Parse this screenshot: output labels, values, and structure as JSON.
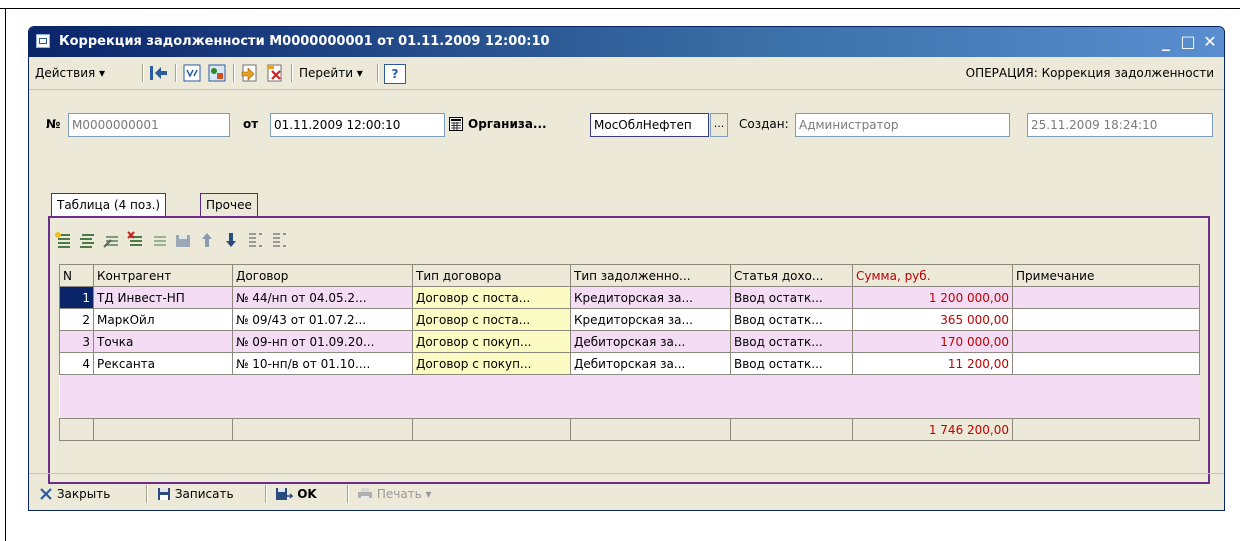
{
  "window": {
    "title": "Коррекция задолженности М0000000001 от 01.11.2009 12:00:10",
    "minimize": "_",
    "maximize": "□",
    "close": "✕"
  },
  "toolbar": {
    "actions_label": "Действия ▾",
    "goto_label": "Перейти ▾",
    "help_label": "?",
    "operation_label": "ОПЕРАЦИЯ: Коррекция задолженности"
  },
  "header": {
    "number_label": "№",
    "number_value": "М0000000001",
    "date_label": "от",
    "date_value": "01.11.2009 12:00:10",
    "org_label": "Организа...",
    "org_value": "МосОблНефтеп",
    "org_select_btn": "...",
    "created_label": "Создан:",
    "created_value": "Администратор",
    "created_date": "25.11.2009 18:24:10"
  },
  "tabs": [
    {
      "label": "Таблица (4 поз.)",
      "active": true
    },
    {
      "label": "Прочее",
      "active": false
    }
  ],
  "table": {
    "columns": [
      "N",
      "Контрагент",
      "Договор",
      "Тип договора",
      "Тип задолженно...",
      "Статья дохо...",
      "Сумма, руб.",
      "Примечание"
    ],
    "rows": [
      {
        "n": "1",
        "contractor": "ТД Инвест-НП",
        "contract": "№ 44/нп от 04.05.2...",
        "contract_type": "Договор с поста...",
        "debt_type": "Кредиторская за...",
        "article": "Ввод остатк...",
        "sum": "1 200 000,00",
        "note": ""
      },
      {
        "n": "2",
        "contractor": "МаркОйл",
        "contract": "№ 09/43 от 01.07.2...",
        "contract_type": "Договор с поста...",
        "debt_type": "Кредиторская за...",
        "article": "Ввод остатк...",
        "sum": "365 000,00",
        "note": ""
      },
      {
        "n": "3",
        "contractor": "Точка",
        "contract": "№ 09-нп от 01.09.20...",
        "contract_type": "Договор с покуп...",
        "debt_type": "Дебиторская за...",
        "article": "Ввод остатк...",
        "sum": "170 000,00",
        "note": ""
      },
      {
        "n": "4",
        "contractor": "Рексанта",
        "contract": "№ 10-нп/в от 01.10....",
        "contract_type": "Договор с покуп...",
        "debt_type": "Дебиторская за...",
        "article": "Ввод остатк...",
        "sum": "11 200,00",
        "note": ""
      }
    ],
    "total_sum": "1 746 200,00"
  },
  "bottom": {
    "close_label": "Закрыть",
    "save_label": "Записать",
    "ok_label": "OK",
    "print_label": "Печать ▾"
  },
  "colors": {
    "accent_purple": "#6b2f8a",
    "sum_red": "#c00000",
    "row_pink": "#f5dcf5",
    "cell_yellow": "#fbfbc3"
  }
}
